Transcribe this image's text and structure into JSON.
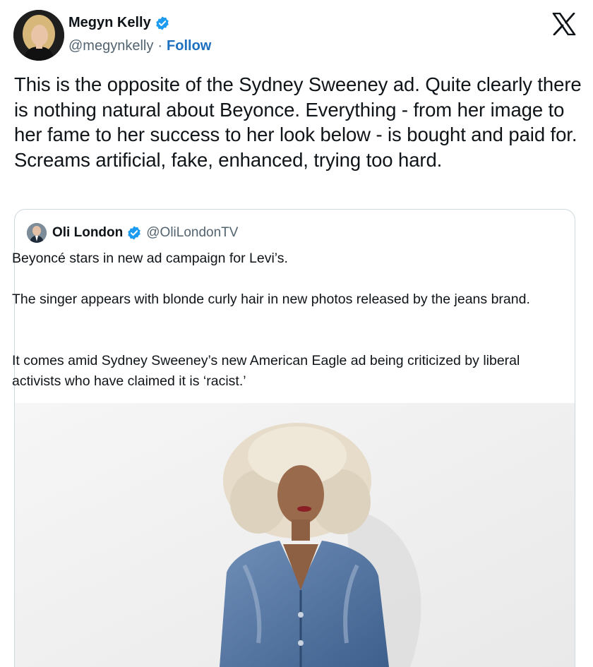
{
  "tweet": {
    "author_name": "Megyn Kelly",
    "handle": "@megynkelly",
    "separator": "·",
    "follow_label": "Follow",
    "text": "This is the opposite of the Sydney Sweeney ad. Quite clearly there is nothing natural about Beyonce. Everything - from her image to her fame to her success to her look below - is bought and paid for. Screams artificial, fake, enhanced, trying too hard."
  },
  "quoted_tweet": {
    "author_name": "Oli London",
    "handle": "@OliLondonTV",
    "paragraphs": [
      "Beyoncé stars in new ad campaign for Levi’s.",
      "The singer appears with blonde curly hair in new photos released by the jeans brand.",
      "It comes amid Sydney Sweeney’s new American Eagle ad being criticized by liberal activists who have claimed it is ‘racist.’"
    ]
  },
  "icons": {
    "verified": "verified-badge-icon",
    "platform": "x-logo-icon"
  },
  "colors": {
    "verified_blue": "#1d9bf0",
    "follow_link": "#1d6fbf",
    "secondary_text": "#536471",
    "border": "#cfd9de"
  }
}
